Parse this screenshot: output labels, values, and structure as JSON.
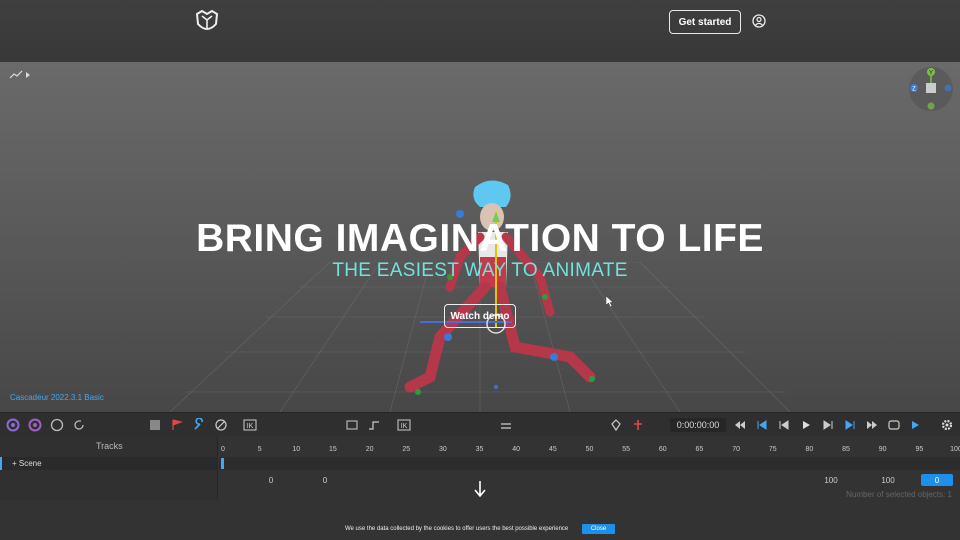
{
  "header": {
    "logo_icon": "cascadeur-logo-icon",
    "get_started_label": "Get started",
    "user_icon": "user-circle-icon"
  },
  "hero": {
    "title": "BRING IMAGINATION TO LIFE",
    "subtitle": "THE EASIEST WAY TO ANIMATE",
    "watch_demo_label": "Watch demo"
  },
  "viewport": {
    "version_label": "Cascadeur 2022.3.1 Basic",
    "gizmo_labels": {
      "y": "Y",
      "z": "Z"
    }
  },
  "toolbar": {
    "time": "0:00:00:00"
  },
  "timeline": {
    "tracks_header": "Tracks",
    "scene_label": "+ Scene",
    "ruler_ticks": [
      "0",
      "5",
      "10",
      "15",
      "20",
      "25",
      "30",
      "35",
      "40",
      "45",
      "50",
      "55",
      "60",
      "65",
      "70",
      "75",
      "80",
      "85",
      "90",
      "95",
      "100"
    ],
    "field_left_1": "0",
    "field_left_2": "0",
    "field_right_1": "100",
    "field_right_2": "100",
    "field_right_3": "0",
    "selected_objects": "Number of selected objects: 1"
  },
  "cookie": {
    "text": "We use the data collected by the cookies to offer users the best possible experience",
    "close_label": "Close"
  },
  "colors": {
    "accent_blue": "#3fa9f5",
    "hero_cyan": "#6fe3df",
    "cookie_button": "#1e90e8"
  }
}
